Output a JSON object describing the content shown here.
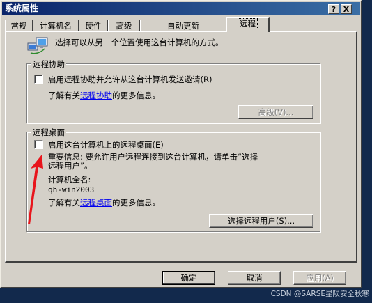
{
  "window": {
    "title": "系统属性",
    "help_btn": "?",
    "close_btn": "X"
  },
  "tabs": [
    {
      "label": "常规"
    },
    {
      "label": "计算机名"
    },
    {
      "label": "硬件"
    },
    {
      "label": "高级"
    },
    {
      "label": "自动更新"
    },
    {
      "label": "远程",
      "active": true
    }
  ],
  "intro": "选择可以从另一个位置使用这台计算机的方式。",
  "remote_assist": {
    "title": "远程协助",
    "checkbox_label": "启用远程协助并允许从这台计算机发送邀请(R)",
    "checked": false,
    "info_prefix": "了解有关",
    "info_link": "远程协助",
    "info_suffix": "的更多信息。",
    "advanced_btn": "高级(V)..."
  },
  "remote_desktop": {
    "title": "远程桌面",
    "checkbox_label": "启用这台计算机上的远程桌面(E)",
    "checked": false,
    "important_line1": "重要信息: 要允许用户远程连接到这台计算机，请单击“选择",
    "important_line2": "远程用户”。",
    "fullname_label": "计算机全名:",
    "fullname_value": "qh-win2003",
    "info_prefix": "了解有关",
    "info_link": "远程桌面",
    "info_suffix": "的更多信息。",
    "select_users_btn": "选择远程用户(S)..."
  },
  "footer": {
    "ok": "确定",
    "cancel": "取消",
    "apply": "应用(A)"
  },
  "watermark": "CSDN @SARSE星陨安全秋寒",
  "colors": {
    "annotation_arrow": "#e8151c",
    "titlebar": "#0a246a",
    "desktop": "#12294c"
  }
}
